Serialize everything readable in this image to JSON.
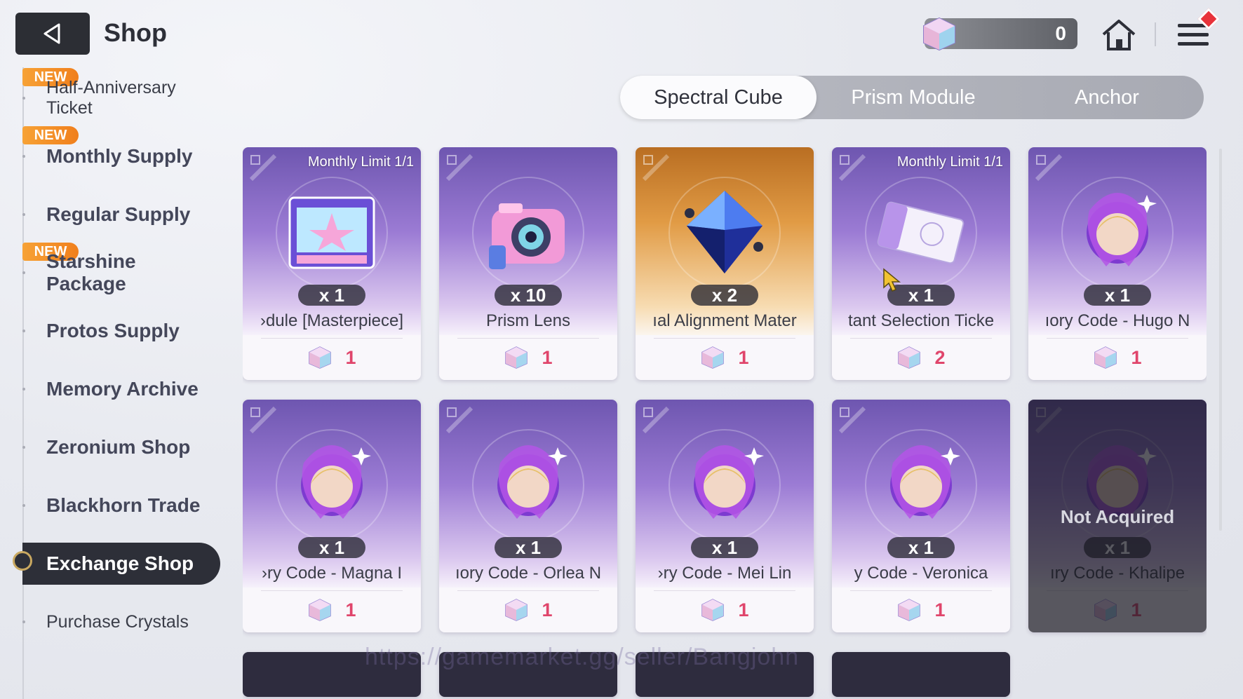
{
  "header": {
    "title": "Shop",
    "currency_value": "0"
  },
  "sidebar": {
    "items": [
      {
        "label": "Half-Anniversary Ticket",
        "new": true,
        "badge": "NEW"
      },
      {
        "label": "Monthly Supply",
        "new": true,
        "badge": "NEW"
      },
      {
        "label": "Regular Supply"
      },
      {
        "label": "Starshine Package",
        "new": true,
        "badge": "NEW"
      },
      {
        "label": "Protos Supply"
      },
      {
        "label": "Memory Archive"
      },
      {
        "label": "Zeronium Shop"
      },
      {
        "label": "Blackhorn Trade"
      },
      {
        "label": "Exchange Shop",
        "active": true
      },
      {
        "label": "Purchase Crystals"
      }
    ]
  },
  "tabs": [
    {
      "label": "Spectral Cube",
      "active": true
    },
    {
      "label": "Prism Module"
    },
    {
      "label": "Anchor"
    }
  ],
  "cards": [
    {
      "limit": "Monthly Limit 1/1",
      "qty": "x 1",
      "name": "›dule [Masterpiece]",
      "price": "1",
      "icon": "film-module-icon"
    },
    {
      "limit": "",
      "qty": "x 10",
      "name": "Prism Lens",
      "price": "1",
      "icon": "camera-icon"
    },
    {
      "limit": "",
      "qty": "x 2",
      "name": "ıal Alignment Mater",
      "price": "1",
      "icon": "crystal-icon",
      "gold": true
    },
    {
      "limit": "Monthly Limit 1/1",
      "qty": "x 1",
      "name": "tant Selection Ticke",
      "price": "2",
      "icon": "ticket-icon"
    },
    {
      "limit": "",
      "qty": "x 1",
      "name": "ıory Code - Hugo   N",
      "price": "1",
      "icon": "memory-code-hugo-icon"
    },
    {
      "limit": "",
      "qty": "x 1",
      "name": "›ry Code - Magna   I",
      "price": "1",
      "icon": "memory-code-magna-icon"
    },
    {
      "limit": "",
      "qty": "x 1",
      "name": "ıory Code - Orlea   N",
      "price": "1",
      "icon": "memory-code-orlea-icon"
    },
    {
      "limit": "",
      "qty": "x 1",
      "name": "›ry Code - Mei Lin",
      "price": "1",
      "icon": "memory-code-mei-lin-icon"
    },
    {
      "limit": "",
      "qty": "x 1",
      "name": "y Code - Veronica",
      "price": "1",
      "icon": "memory-code-veronica-icon"
    },
    {
      "limit": "",
      "qty": "x 1",
      "name": "ıry Code - Khalipe",
      "price": "1",
      "icon": "memory-code-khalipe-icon",
      "locked": true,
      "status": "Not Acquired"
    }
  ],
  "watermark": "https://gamemarket.gg/seller/Bangjohn",
  "colors": {
    "price": "#e0456b",
    "active_nav": "#2d2f38",
    "new_badge": "#f28a26",
    "card_purple": "#9b7bd4",
    "card_gold": "#e19b45"
  }
}
